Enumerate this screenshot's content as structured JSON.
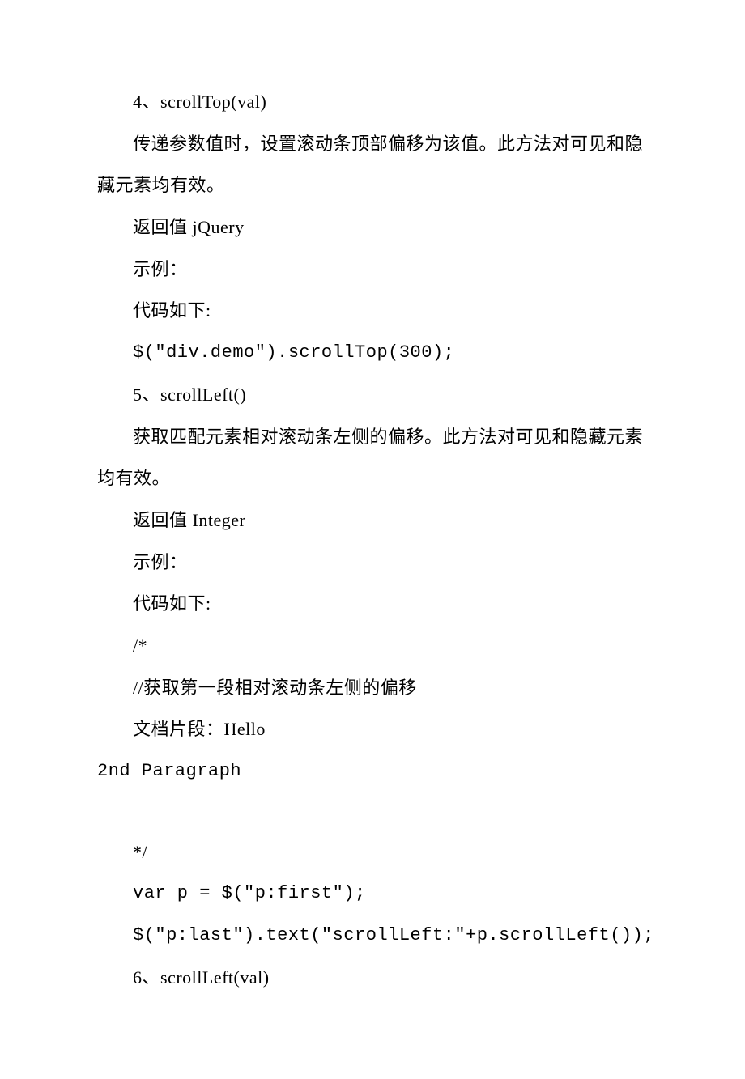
{
  "lines": [
    {
      "text": "4、scrollTop(val)",
      "indent": true
    },
    {
      "text": "传递参数值时，设置滚动条顶部偏移为该值。此方法对可见和隐藏元素均有效。",
      "indent": true,
      "wrap": true
    },
    {
      "text": "返回值 jQuery",
      "indent": true
    },
    {
      "text": "示例：",
      "indent": true
    },
    {
      "text": "代码如下:",
      "indent": true
    },
    {
      "text": "$(\"div.demo\").scrollTop(300);",
      "indent": true,
      "mono": true
    },
    {
      "text": "5、scrollLeft()",
      "indent": true
    },
    {
      "text": "获取匹配元素相对滚动条左侧的偏移。此方法对可见和隐藏元素均有效。",
      "indent": true,
      "wrap": true
    },
    {
      "text": "返回值 Integer",
      "indent": true
    },
    {
      "text": "示例：",
      "indent": true
    },
    {
      "text": "代码如下:",
      "indent": true
    },
    {
      "text": "/*",
      "indent": true
    },
    {
      "text": "//获取第一段相对滚动条左侧的偏移",
      "indent": true
    },
    {
      "text": "文档片段：Hello",
      "indent": true
    },
    {
      "text": "2nd Paragraph",
      "indent": false,
      "mono": true
    },
    {
      "blank": true
    },
    {
      "text": "*/",
      "indent": true
    },
    {
      "text": "var p = $(\"p:first\");",
      "indent": true,
      "mono": true
    },
    {
      "text": "$(\"p:last\").text(\"scrollLeft:\"+p.scrollLeft());",
      "indent": true,
      "mono": true
    },
    {
      "text": "6、scrollLeft(val)",
      "indent": true
    }
  ]
}
